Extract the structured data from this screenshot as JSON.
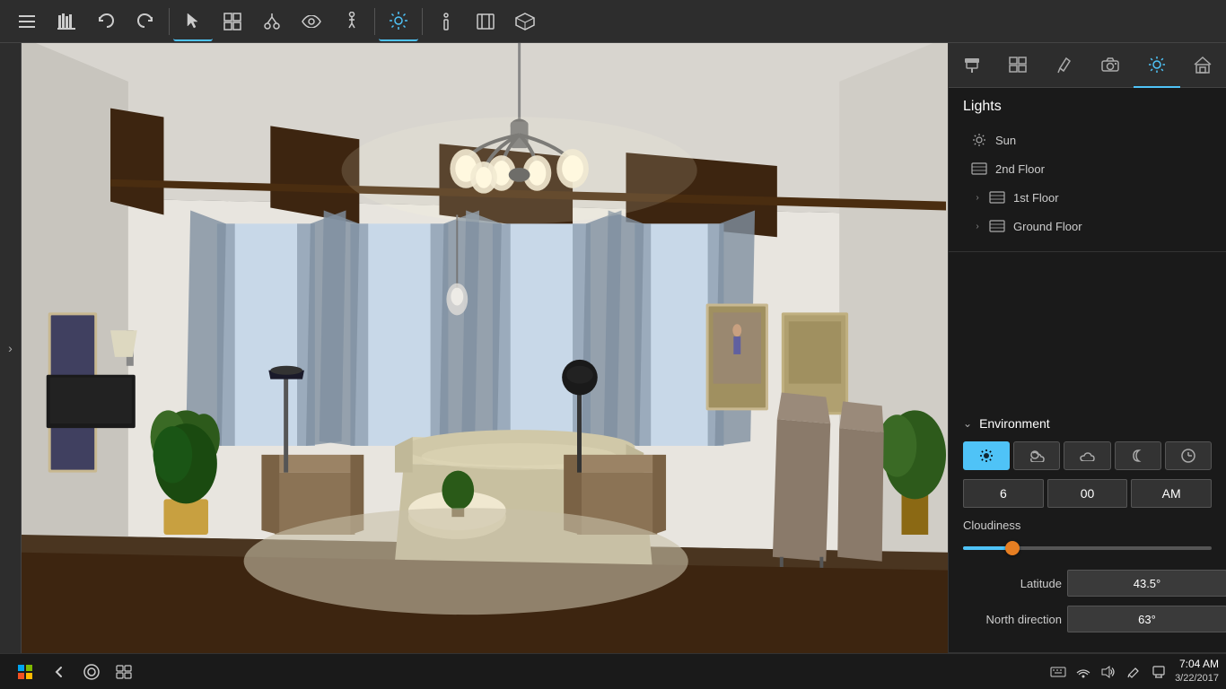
{
  "toolbar": {
    "undo_label": "↩",
    "redo_label": "↪",
    "menu_label": "☰",
    "library_label": "📚"
  },
  "panel": {
    "icon_bar": {
      "hammer_icon": "🔨",
      "grid_icon": "⊞",
      "pen_icon": "✏",
      "camera_icon": "📷",
      "sun_icon": "☀",
      "home_icon": "⌂"
    },
    "lights_title": "Lights",
    "lights_items": [
      {
        "name": "Sun",
        "icon": "sun"
      },
      {
        "name": "2nd Floor",
        "icon": "floor"
      },
      {
        "name": "1st Floor",
        "icon": "floor",
        "expandable": true
      },
      {
        "name": "Ground Floor",
        "icon": "floor",
        "expandable": true
      }
    ],
    "environment": {
      "title": "Environment",
      "time_buttons": [
        {
          "id": "clear",
          "icon": "☀",
          "active": true
        },
        {
          "id": "partly",
          "icon": "⛅",
          "active": false
        },
        {
          "id": "cloudy",
          "icon": "☁",
          "active": false
        },
        {
          "id": "night",
          "icon": "☾",
          "active": false
        },
        {
          "id": "clock",
          "icon": "🕐",
          "active": false
        }
      ],
      "time_hour": "6",
      "time_minutes": "00",
      "time_period": "AM",
      "cloudiness_label": "Cloudiness",
      "cloudiness_value": 20,
      "latitude_label": "Latitude",
      "latitude_value": "43.5°",
      "north_label": "North direction",
      "north_value": "63°"
    }
  },
  "taskbar": {
    "time": "7:04 AM",
    "date": "3/22/2017",
    "start_icon": "⊞"
  }
}
